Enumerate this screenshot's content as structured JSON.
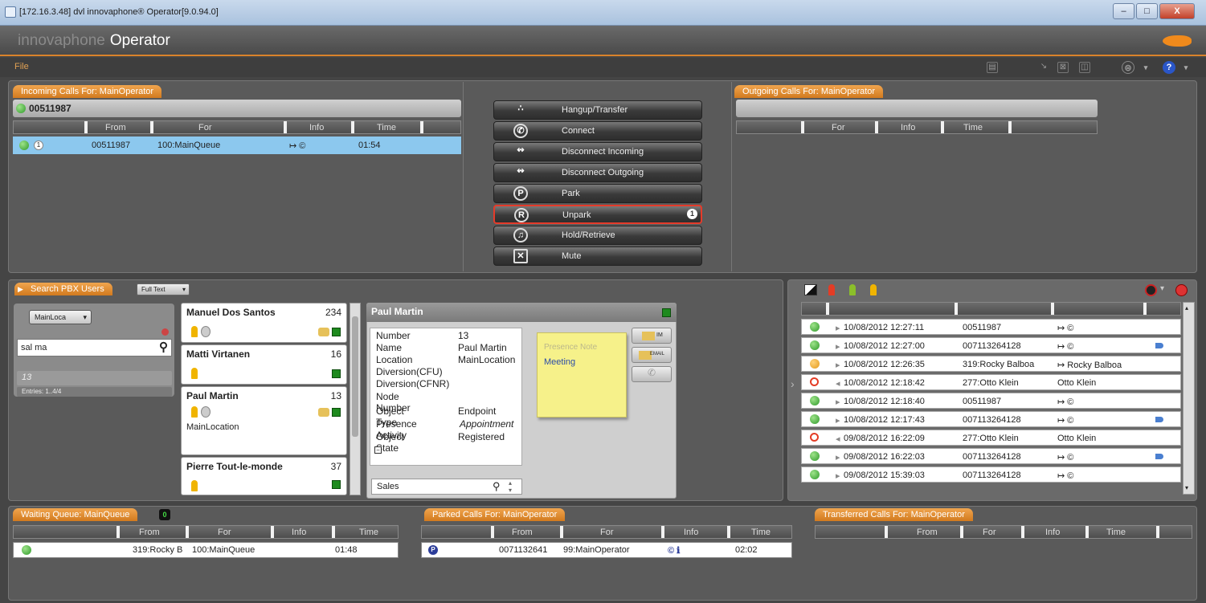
{
  "window": {
    "title": "[172.16.3.48] dvl innovaphone® Operator[9.0.94.0]",
    "btn_min": "–",
    "btn_max": "□",
    "btn_close": "X"
  },
  "app": {
    "brand": "innovaphone",
    "name": "Operator",
    "menu_file": "File",
    "help": "?"
  },
  "incoming": {
    "tab": "Incoming Calls For: MainOperator",
    "filter_value": "00511987",
    "columns": [
      "From",
      "For",
      "Info",
      "Time"
    ],
    "rows": [
      {
        "badge": "1",
        "from": "00511987",
        "for": "100:MainQueue",
        "info": "↦ ©",
        "time": "01:54"
      }
    ]
  },
  "actions": {
    "buttons": [
      {
        "icon": "∴",
        "label": "Hangup/Transfer"
      },
      {
        "icon": "✆",
        "label": "Connect"
      },
      {
        "icon": "↭",
        "label": "Disconnect Incoming"
      },
      {
        "icon": "↭",
        "label": "Disconnect Outgoing"
      },
      {
        "icon": "P",
        "label": "Park"
      },
      {
        "icon": "R",
        "label": "Unpark"
      },
      {
        "icon": "♫",
        "label": "Hold/Retrieve"
      },
      {
        "icon": "✕",
        "label": "Mute"
      }
    ],
    "unpark_badge": "1"
  },
  "outgoing": {
    "tab": "Outgoing Calls For: MainOperator",
    "columns": [
      "For",
      "Info",
      "Time"
    ]
  },
  "search": {
    "tab": "Search PBX Users",
    "mode": "Full Text",
    "location_select": "MainLoca",
    "query": "sal ma",
    "result": "13",
    "entries": "Entries: 1..4/4"
  },
  "users": [
    {
      "name": "Manuel Dos Santos",
      "number": "234",
      "location": ""
    },
    {
      "name": "Matti Virtanen",
      "number": "16",
      "location": ""
    },
    {
      "name": "Paul Martin",
      "number": "13",
      "location": "MainLocation"
    },
    {
      "name": "Pierre Tout-le-monde",
      "number": "37",
      "location": ""
    }
  ],
  "detail": {
    "title": "Paul Martin",
    "fields": [
      {
        "k": "Number",
        "v": "13"
      },
      {
        "k": "Name",
        "v": "Paul Martin"
      },
      {
        "k": "Location",
        "v": "MainLocation"
      },
      {
        "k": "Diversion(CFU)",
        "v": ""
      },
      {
        "k": "Diversion(CFNR)",
        "v": ""
      },
      {
        "k": "Node Number",
        "v": ""
      },
      {
        "k": "Object Type",
        "v": "Endpoint"
      },
      {
        "k": "Presence Activity",
        "v": "Appointment"
      },
      {
        "k": "Object State",
        "v": "Registered"
      }
    ],
    "group_input": "Sales",
    "note_title": "Presence Note",
    "note_text": "Meeting",
    "btn_im": "IM",
    "btn_email": "EMAIL"
  },
  "log": {
    "rows": [
      {
        "status": "green",
        "dir": "▸",
        "date": "10/08/2012 12:27:11",
        "num": "00511987",
        "info": "↦ ©",
        "tag": false
      },
      {
        "status": "green",
        "dir": "▸",
        "date": "10/08/2012 12:27:00",
        "num": "007113264128",
        "info": "↦ ©",
        "tag": true
      },
      {
        "status": "orange",
        "dir": "▸",
        "date": "10/08/2012 12:26:35",
        "num": "319:Rocky Balboa",
        "info": "↦ Rocky Balboa",
        "tag": false
      },
      {
        "status": "red",
        "dir": "◂",
        "date": "10/08/2012 12:18:42",
        "num": "277:Otto Klein",
        "info": "Otto Klein",
        "tag": false
      },
      {
        "status": "green",
        "dir": "▸",
        "date": "10/08/2012 12:18:40",
        "num": "00511987",
        "info": "↦ ©",
        "tag": false
      },
      {
        "status": "green",
        "dir": "▸",
        "date": "10/08/2012 12:17:43",
        "num": "007113264128",
        "info": "↦ ©",
        "tag": true
      },
      {
        "status": "red",
        "dir": "◂",
        "date": "09/08/2012 16:22:09",
        "num": "277:Otto Klein",
        "info": "Otto Klein",
        "tag": false
      },
      {
        "status": "green",
        "dir": "▸",
        "date": "09/08/2012 16:22:03",
        "num": "007113264128",
        "info": "↦ ©",
        "tag": true
      },
      {
        "status": "green",
        "dir": "▸",
        "date": "09/08/2012 15:39:03",
        "num": "007113264128",
        "info": "↦ ©",
        "tag": false
      }
    ]
  },
  "waiting": {
    "tab": "Waiting Queue: MainQueue",
    "count": "0",
    "columns": [
      "From",
      "For",
      "Info",
      "Time"
    ],
    "rows": [
      {
        "from": "319:Rocky B",
        "for": "100:MainQueue",
        "time": "01:48"
      }
    ]
  },
  "parked": {
    "tab": "Parked Calls For: MainOperator",
    "columns": [
      "From",
      "For",
      "Info",
      "Time"
    ],
    "rows": [
      {
        "from": "0071132641",
        "for": "99:MainOperator",
        "info": "© ℹ",
        "time": "02:02"
      }
    ]
  },
  "transferred": {
    "tab": "Transferred Calls For: MainOperator",
    "columns": [
      "From",
      "For",
      "Info",
      "Time"
    ]
  },
  "colors": {
    "accent": "#d9822b",
    "panel": "#5a5a5a",
    "selected": "#8cc8ee",
    "unpark_border": "#e53b2a"
  }
}
